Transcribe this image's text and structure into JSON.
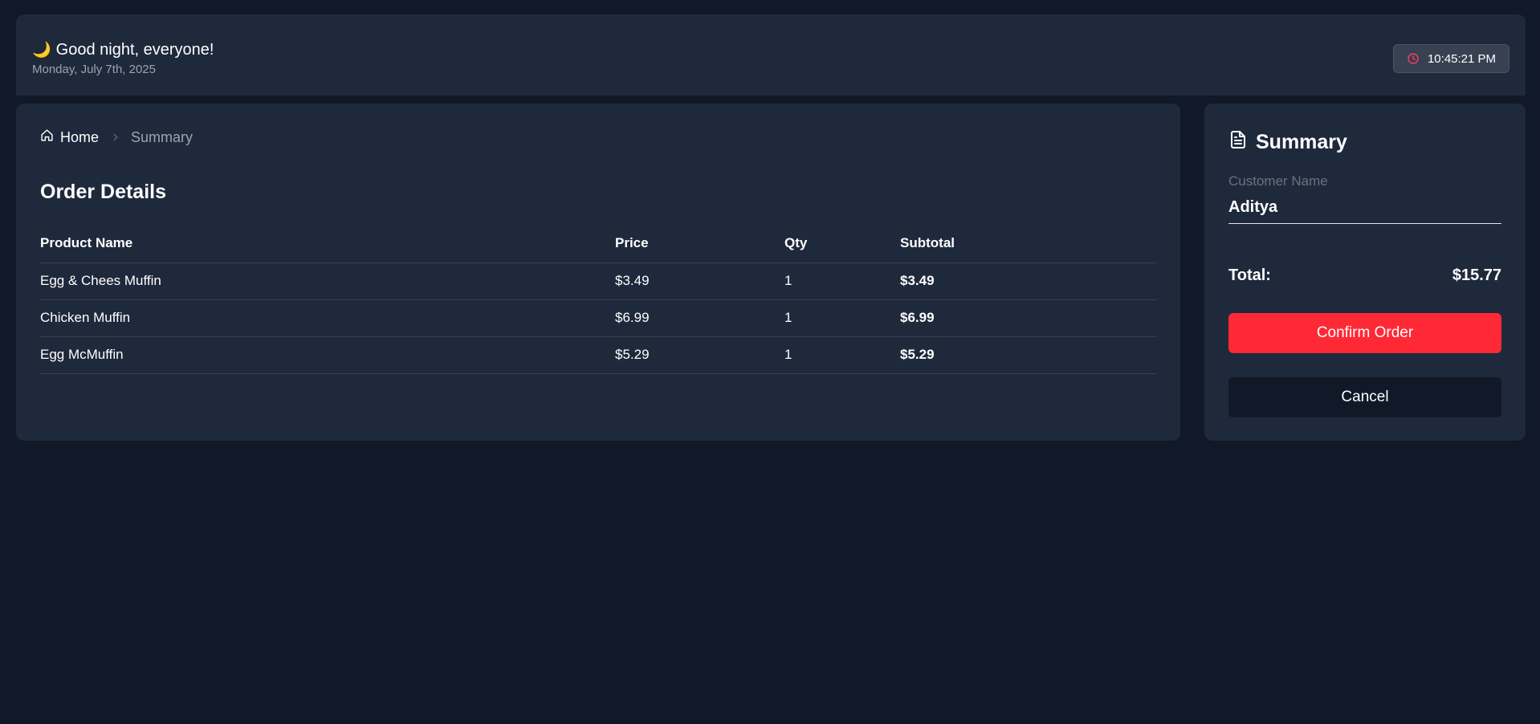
{
  "header": {
    "greeting_emoji": "🌙",
    "greeting": "Good night, everyone!",
    "date": "Monday, July 7th, 2025",
    "time": "10:45:21 PM",
    "clock_icon": "clock-icon",
    "clock_icon_color": "#f43f5e"
  },
  "breadcrumb": {
    "home_icon": "home-icon",
    "home": "Home",
    "separator_icon": "chevron-right-icon",
    "current": "Summary"
  },
  "order": {
    "title": "Order Details",
    "columns": [
      "Product Name",
      "Price",
      "Qty",
      "Subtotal"
    ],
    "rows": [
      {
        "name": "Egg & Chees Muffin",
        "price": "$3.49",
        "qty": "1",
        "subtotal": "$3.49"
      },
      {
        "name": "Chicken Muffin",
        "price": "$6.99",
        "qty": "1",
        "subtotal": "$6.99"
      },
      {
        "name": "Egg McMuffin",
        "price": "$5.29",
        "qty": "1",
        "subtotal": "$5.29"
      }
    ]
  },
  "summary": {
    "icon": "document-icon",
    "title": "Summary",
    "customer_label": "Customer Name",
    "customer_value": "Aditya",
    "total_label": "Total:",
    "total_value": "$15.77",
    "confirm_label": "Confirm Order",
    "cancel_label": "Cancel"
  },
  "colors": {
    "background": "#111827",
    "card": "#1e293b",
    "accent": "#ff2936"
  }
}
